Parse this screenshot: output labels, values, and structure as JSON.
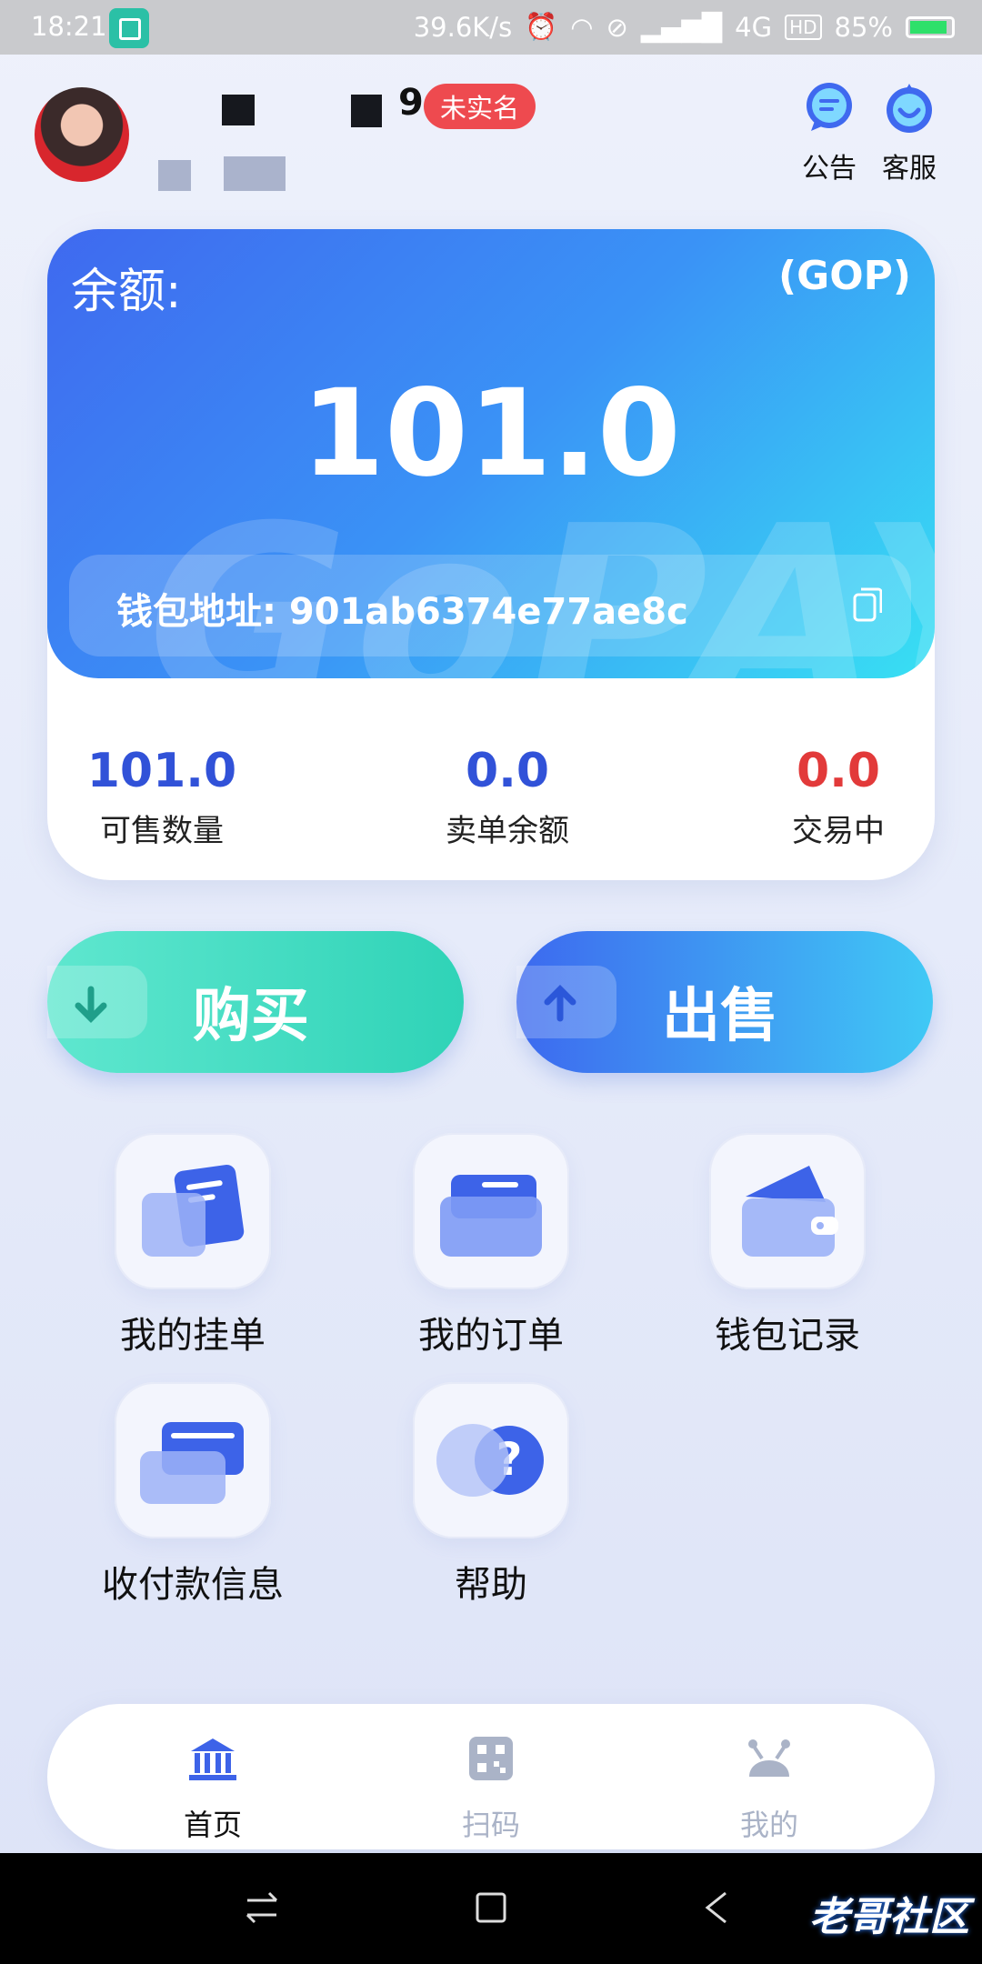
{
  "status_bar": {
    "time": "18:21",
    "speed": "39.6K/s",
    "network": "4G",
    "hd": "HD",
    "battery": "85%"
  },
  "header": {
    "uid_digit": "9",
    "verify_badge": "未实名",
    "announce_label": "公告",
    "service_label": "客服"
  },
  "balance_card": {
    "label": "余额:",
    "unit": "(GOP)",
    "amount": "101.0",
    "watermark": "GoPAY",
    "address_label": "钱包地址: 901ab6374e77ae8c"
  },
  "stats": [
    {
      "value": "101.0",
      "label": "可售数量",
      "color": "#3152d8"
    },
    {
      "value": "0.0",
      "label": "卖单余额",
      "color": "#3152d8"
    },
    {
      "value": "0.0",
      "label": "交易中",
      "color": "#e23a3a"
    }
  ],
  "actions": {
    "buy": "购买",
    "sell": "出售"
  },
  "menu": [
    {
      "label": "我的挂单",
      "icon": "listing-icon"
    },
    {
      "label": "我的订单",
      "icon": "folder-icon"
    },
    {
      "label": "钱包记录",
      "icon": "wallet-icon"
    },
    {
      "label": "收付款信息",
      "icon": "card-icon"
    },
    {
      "label": "帮助",
      "icon": "help-icon"
    }
  ],
  "nav": [
    {
      "label": "首页",
      "icon": "home-bank-icon",
      "active": true
    },
    {
      "label": "扫码",
      "icon": "qr-icon",
      "active": false
    },
    {
      "label": "我的",
      "icon": "profile-icon",
      "active": false
    }
  ],
  "colors": {
    "accent_blue": "#3f69ef",
    "accent_teal": "#2fd3b7",
    "danger": "#e23a3a",
    "inactive": "#aab3c7"
  },
  "footer_watermark": "老哥社区"
}
